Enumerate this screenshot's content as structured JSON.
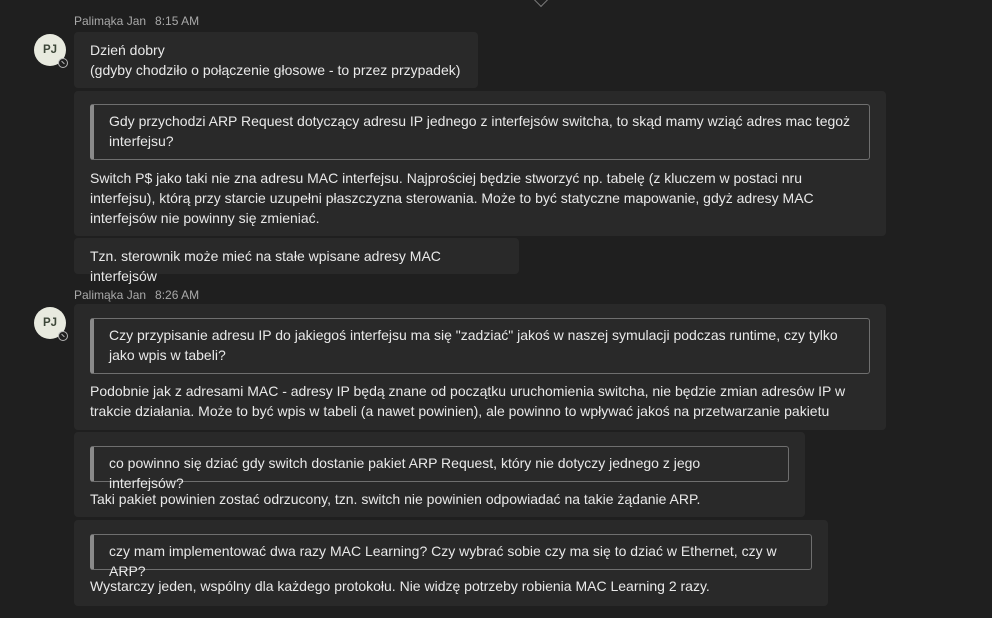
{
  "messages": [
    {
      "author": "Palimąka Jan",
      "time": "8:15 AM",
      "avatar_initials": "PJ",
      "greeting": "Dzień dobry\n(gdyby chodziło o połączenie głosowe - to przez przypadek)",
      "reply1": {
        "quote": "Gdy przychodzi ARP Request dotyczący adresu IP jednego z interfejsów switcha, to skąd mamy wziąć adres mac tegoż interfejsu?",
        "answer": "Switch P$ jako taki nie zna adresu MAC interfejsu. Najprościej będzie stworzyć np. tabelę (z kluczem w postaci nru interfejsu), którą przy starcie uzupełni płaszczyzna sterowania. Może to być statyczne mapowanie, gdyż adresy MAC interfejsów nie powinny się zmieniać."
      },
      "followup": "Tzn. sterownik może mieć na stałe wpisane adresy MAC interfejsów"
    },
    {
      "author": "Palimąka Jan",
      "time": "8:26 AM",
      "avatar_initials": "PJ",
      "reply1": {
        "quote": "Czy przypisanie adresu IP do jakiegoś interfejsu ma się \"zadziać\" jakoś w naszej symulacji podczas runtime, czy tylko jako wpis w tabeli?",
        "answer": "Podobnie jak z adresami MAC - adresy IP będą znane od początku uruchomienia switcha, nie będzie zmian adresów IP w trakcie działania. Może to być wpis w tabeli (a nawet powinien), ale powinno to wpływać jakoś na przetwarzanie pakietu"
      },
      "reply2": {
        "quote": "co powinno się dziać gdy switch dostanie pakiet ARP Request, który nie dotyczy jednego z jego interfejsów?",
        "answer": "Taki pakiet powinien zostać odrzucony, tzn. switch nie powinien odpowiadać na takie żądanie ARP."
      },
      "reply3": {
        "quote": "czy mam implementować dwa razy MAC Learning? Czy wybrać sobie czy ma się to dziać w Ethernet, czy w ARP?",
        "answer": "Wystarczy jeden, wspólny dla każdego protokołu. Nie widzę potrzeby robienia MAC Learning 2 razy."
      }
    }
  ]
}
